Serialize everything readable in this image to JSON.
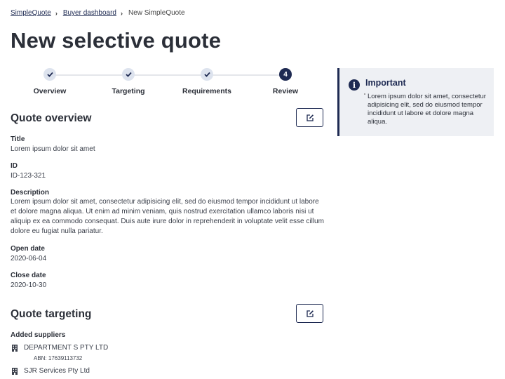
{
  "breadcrumb": {
    "items": [
      "SimpleQuote",
      "Buyer dashboard"
    ],
    "current": "New SimpleQuote"
  },
  "page": {
    "title": "New selective quote"
  },
  "stepper": {
    "steps": [
      {
        "label": "Overview",
        "state": "complete"
      },
      {
        "label": "Targeting",
        "state": "complete"
      },
      {
        "label": "Requirements",
        "state": "complete"
      },
      {
        "label": "Review",
        "state": "current",
        "number": "4"
      }
    ]
  },
  "overview": {
    "title": "Quote overview",
    "fields": {
      "title": {
        "label": "Title",
        "value": "Lorem ipsum dolor sit amet"
      },
      "id": {
        "label": "ID",
        "value": "ID-123-321"
      },
      "description": {
        "label": "Description",
        "value": "Lorem ipsum dolor sit amet, consectetur adipisicing elit, sed do eiusmod tempor incididunt ut labore et dolore magna aliqua. Ut enim ad minim veniam, quis nostrud exercitation ullamco laboris nisi ut aliquip ex ea commodo consequat. Duis aute irure dolor in reprehenderit in voluptate velit esse cillum dolore eu fugiat nulla pariatur."
      },
      "open_date": {
        "label": "Open date",
        "value": "2020-06-04"
      },
      "close_date": {
        "label": "Close date",
        "value": "2020-10-30"
      }
    }
  },
  "targeting": {
    "title": "Quote targeting",
    "added_suppliers_label": "Added suppliers",
    "suppliers": [
      {
        "name": "DEPARTMENT S PTY LTD",
        "abn": "ABN: 17639113732"
      },
      {
        "name": "SJR Services Pty Ltd"
      }
    ]
  },
  "callout": {
    "title": "Important",
    "text": "Lorem ipsum dolor sit amet, consectetur adipisicing elit, sed do eiusmod tempor incididunt ut labore et dolore magna aliqua."
  },
  "icons": {
    "edit": "edit-icon",
    "supplier": "building-icon",
    "info": "info-icon",
    "check": "check-icon"
  },
  "colors": {
    "primary": "#1e2a52",
    "step_complete_bg": "#dde3ee",
    "callout_bg": "#eef0f4"
  }
}
